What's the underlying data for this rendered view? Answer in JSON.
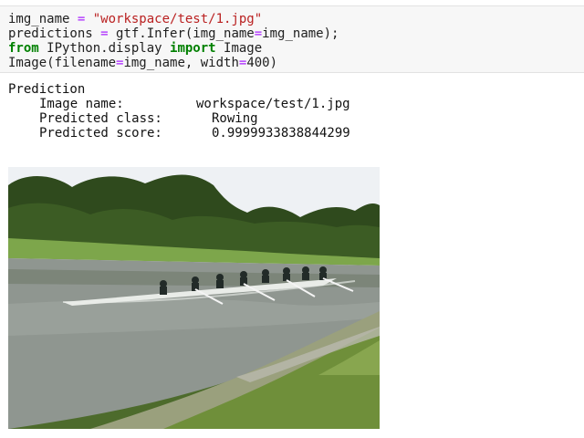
{
  "code_cell": {
    "line1": {
      "var": "img_name",
      "op": " = ",
      "value": "\"workspace/test/1.jpg\""
    },
    "line2": {
      "lhs": "predictions",
      "op": " = ",
      "call": "gtf.Infer(img_name",
      "eq": "=",
      "arg": "img_name);"
    },
    "line3": {
      "kw_from": "from",
      "module": " IPython.display ",
      "kw_import": "import",
      "name": " Image"
    },
    "line4": {
      "call": "Image(filename",
      "eq1": "=",
      "arg1": "img_name, width",
      "eq2": "=",
      "arg2": "400)"
    }
  },
  "output": {
    "heading": "Prediction",
    "image_name_label": "Image name:",
    "image_name_value": "workspace/test/1.jpg",
    "predicted_class_label": "Predicted class:",
    "predicted_class_value": "Rowing",
    "predicted_score_label": "Predicted score:",
    "predicted_score_value": "0.9999933838844299"
  },
  "image": {
    "description_icon": "rowing-photo"
  }
}
